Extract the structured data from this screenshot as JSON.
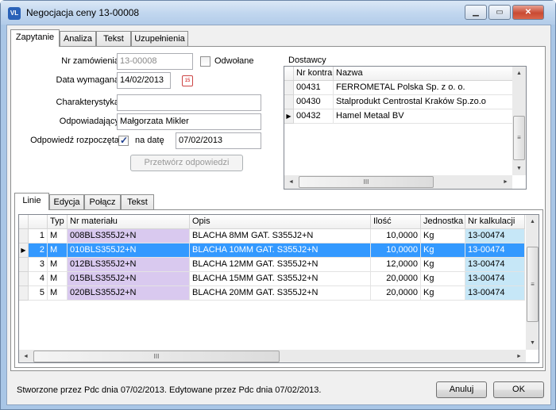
{
  "window": {
    "title": "Negocjacja ceny 13-00008",
    "app_icon_text": "VL",
    "min_glyph": "▁",
    "max_glyph": "▭",
    "close_glyph": "✕"
  },
  "tabs_top": [
    "Zapytanie",
    "Analiza",
    "Tekst",
    "Uzupełnienia"
  ],
  "form": {
    "nr_zamowienia_label": "Nr zamówienia",
    "nr_zamowienia_value": "13-00008",
    "odwolane_label": "Odwołane",
    "odwolane_checked": false,
    "data_wymagana_label": "Data wymagana",
    "data_wymagana_value": "14/02/2013",
    "calendar_icon_text": "15",
    "charakterystyka_label": "Charakterystyka",
    "charakterystyka_value": "",
    "odpowiadajacy_label": "Odpowiadający",
    "odpowiadajacy_value": "Małgorzata Mikler",
    "odpowiedz_label": "Odpowiedź rozpoczęta",
    "odpowiedz_checked": true,
    "na_date_label": "na datę",
    "na_date_value": "07/02/2013",
    "przetworz_label": "Przetwórz odpowiedzi"
  },
  "dostawcy": {
    "label": "Dostawcy",
    "columns": [
      "Nr kontra",
      "Nazwa"
    ],
    "rows": [
      {
        "nr": "00431",
        "nazwa": "FERROMETAL Polska Sp. z o. o."
      },
      {
        "nr": "00430",
        "nazwa": "Stalprodukt Centrostal Kraków Sp.zo.o"
      },
      {
        "nr": "00432",
        "nazwa": "Hamel Metaal BV"
      }
    ],
    "current_row": 2
  },
  "tabs_bottom": [
    "Linie",
    "Edycja",
    "Połącz",
    "Tekst"
  ],
  "linie": {
    "columns": [
      "",
      "Typ",
      "Nr materiału",
      "Opis",
      "Ilość",
      "Jednostka",
      "Nr kalkulacji"
    ],
    "rows": [
      {
        "n": "1",
        "typ": "M",
        "nr": "008BLS355J2+N",
        "opis": "BLACHA    8MM GAT. S355J2+N",
        "ilosc": "10,0000",
        "jedn": "Kg",
        "kalk": "13-00474"
      },
      {
        "n": "2",
        "typ": "M",
        "nr": "010BLS355J2+N",
        "opis": "BLACHA   10MM GAT. S355J2+N",
        "ilosc": "10,0000",
        "jedn": "Kg",
        "kalk": "13-00474"
      },
      {
        "n": "3",
        "typ": "M",
        "nr": "012BLS355J2+N",
        "opis": "BLACHA   12MM GAT. S355J2+N",
        "ilosc": "12,0000",
        "jedn": "Kg",
        "kalk": "13-00474"
      },
      {
        "n": "4",
        "typ": "M",
        "nr": "015BLS355J2+N",
        "opis": "BLACHA   15MM GAT. S355J2+N",
        "ilosc": "20,0000",
        "jedn": "Kg",
        "kalk": "13-00474"
      },
      {
        "n": "5",
        "typ": "M",
        "nr": "020BLS355J2+N",
        "opis": "BLACHA   20MM GAT. S355J2+N",
        "ilosc": "20,0000",
        "jedn": "Kg",
        "kalk": "13-00474"
      }
    ],
    "selected_row": 1
  },
  "scroll": {
    "up": "▲",
    "down": "▼",
    "left": "◄",
    "right": "►",
    "grip": "≡",
    "hgrip": "III"
  },
  "colors": {
    "selection": "#3399ff",
    "material": "#d9c9ef",
    "kalkulacja": "#c6e7f7"
  },
  "footer": {
    "status": "Stworzone przez Pdc dnia 07/02/2013. Edytowane przez Pdc dnia 07/02/2013.",
    "anuluj": "Anuluj",
    "ok": "OK"
  }
}
